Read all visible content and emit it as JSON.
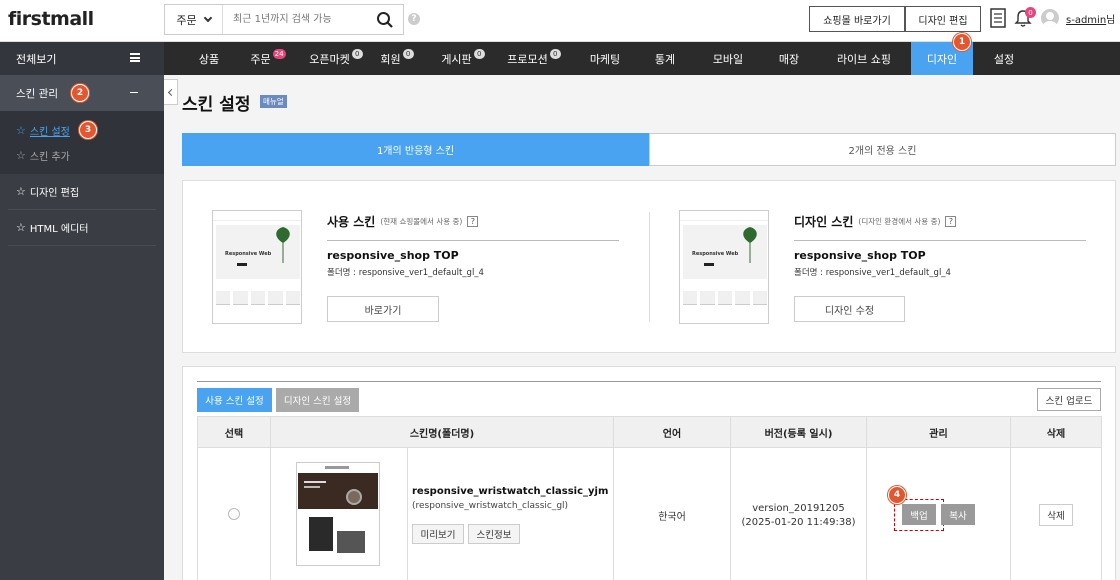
{
  "header": {
    "logo": "firstmall",
    "search": {
      "category": "주문",
      "placeholder": "최근 1년까지 검색 가능"
    },
    "help": "?",
    "go_to_mall_label": "쇼핑몰 바로가기",
    "design_edit_label": "디자인 편집",
    "notification_count": "0",
    "user_name": "s-admin",
    "user_suffix": "님"
  },
  "nav": {
    "all_label": "전체보기",
    "items": [
      {
        "label": "상품",
        "badge": ""
      },
      {
        "label": "주문",
        "badge": "24"
      },
      {
        "label": "오픈마켓",
        "badge": "0"
      },
      {
        "label": "회원",
        "badge": "0"
      },
      {
        "label": "게시판",
        "badge": "0"
      },
      {
        "label": "프로모션",
        "badge": "0"
      },
      {
        "label": "마케팅",
        "badge": ""
      },
      {
        "label": "통계",
        "badge": ""
      },
      {
        "label": "모바일",
        "badge": ""
      },
      {
        "label": "매장",
        "badge": ""
      },
      {
        "label": "라이브 쇼핑",
        "badge": ""
      },
      {
        "label": "디자인",
        "badge": ""
      },
      {
        "label": "설정",
        "badge": ""
      }
    ],
    "active_index": 11
  },
  "sidebar": {
    "group_label": "스킨 관리",
    "sub_items": [
      "스킨 설정",
      "스킨 추가"
    ],
    "items": [
      "디자인 편집",
      "HTML 에디터"
    ]
  },
  "steps": [
    "1",
    "2",
    "3",
    "4"
  ],
  "page": {
    "title": "스킨 설정",
    "manual_badge": "매뉴얼",
    "tabs": [
      "1개의 반응형 스킨",
      "2개의 전용 스킨"
    ]
  },
  "skins_panel": {
    "use": {
      "heading": "사용 스킨",
      "note": "(현재 쇼핑몰에서 사용 중)",
      "name": "responsive_shop TOP",
      "folder": "폴더명 : responsive_ver1_default_gl_4",
      "button": "바로가기"
    },
    "design": {
      "heading": "디자인 스킨",
      "note": "(디자인 환경에서 사용 중)",
      "name": "responsive_shop TOP",
      "folder": "폴더명 : responsive_ver1_default_gl_4",
      "button": "디자인 수정"
    },
    "thumb_text": "Responsive Web"
  },
  "list": {
    "buttons": {
      "use_skin": "사용 스킨 설정",
      "design_skin": "디자인 스킨 설정",
      "upload": "스킨 업로드"
    },
    "columns": [
      "선택",
      "스킨명(폴더명)",
      "언어",
      "버전(등록 일시)",
      "관리",
      "삭제"
    ],
    "rows": [
      {
        "name": "responsive_wristwatch_classic_yjm",
        "folder": "(responsive_wristwatch_classic_gl)",
        "preview": "미리보기",
        "info": "스킨정보",
        "language": "한국어",
        "version": "version_20191205",
        "date": "(2025-01-20 11:49:38)",
        "backup": "백업",
        "copy": "복사",
        "delete": "삭제"
      }
    ]
  },
  "colors": {
    "accent": "#4aa3f0",
    "step": "#e2572f",
    "nav_bg": "#2b2b2b",
    "sidebar_bg": "#3a3d44"
  }
}
